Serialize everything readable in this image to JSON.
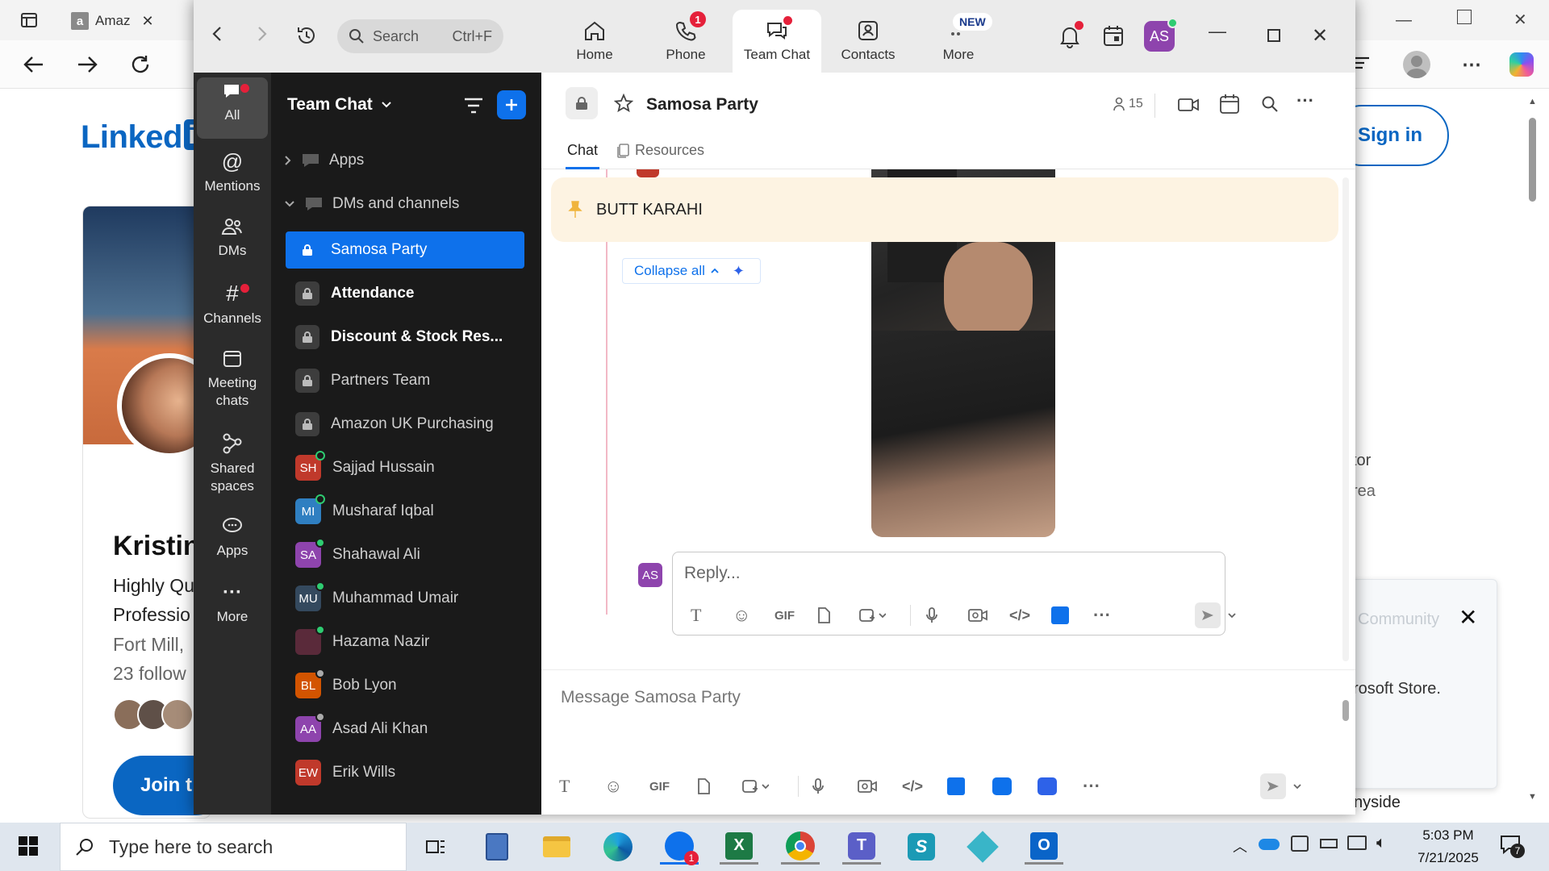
{
  "browser": {
    "tab_title": "Amaz",
    "page": {
      "logo": "Linked",
      "signin": "Sign in",
      "name": "Kristin",
      "headline1": "Highly Qu",
      "headline2": "Professio",
      "location": "Fort Mill,",
      "followers": "23 follow",
      "join": "Join t",
      "right1": "tor",
      "right2": "rea",
      "right3": "rosoft Store.",
      "right4": "nyside",
      "popup_text": "Community"
    }
  },
  "zoom": {
    "search_placeholder": "Search",
    "search_shortcut": "Ctrl+F",
    "nav": [
      {
        "label": "Home",
        "icon": "home-icon"
      },
      {
        "label": "Phone",
        "icon": "phone-icon",
        "badge": "1"
      },
      {
        "label": "Team Chat",
        "icon": "team-chat-icon"
      },
      {
        "label": "Contacts",
        "icon": "contacts-icon"
      },
      {
        "label": "More",
        "icon": "more-icon",
        "badge": "NEW"
      }
    ],
    "avatar_initials": "AS",
    "rail": [
      {
        "label": "All"
      },
      {
        "label": "Mentions"
      },
      {
        "label": "DMs"
      },
      {
        "label": "Channels"
      },
      {
        "label": "Meeting chats"
      },
      {
        "label": "Shared spaces"
      },
      {
        "label": "Apps"
      },
      {
        "label": "More"
      }
    ],
    "list": {
      "title": "Team Chat",
      "sections": [
        "Apps",
        "DMs and channels"
      ],
      "channels": [
        "Samosa Party",
        "Attendance",
        "Discount & Stock Res...",
        "Partners Team",
        "Amazon UK Purchasing"
      ],
      "dms": [
        {
          "initials": "SH",
          "name": "Sajjad Hussain",
          "color": "#c0392b"
        },
        {
          "initials": "MI",
          "name": "Musharaf Iqbal",
          "color": "#2f7fc1"
        },
        {
          "initials": "SA",
          "name": "Shahawal Ali",
          "color": "#8e44ad"
        },
        {
          "initials": "MU",
          "name": "Muhammad Umair",
          "color": "#34495e"
        },
        {
          "initials": "",
          "name": "Hazama Nazir",
          "color": "#5a2a3a"
        },
        {
          "initials": "BL",
          "name": "Bob Lyon",
          "color": "#d35400"
        },
        {
          "initials": "AA",
          "name": "Asad Ali Khan",
          "color": "#8e44ad"
        },
        {
          "initials": "EW",
          "name": "Erik Wills",
          "color": "#c0392b"
        }
      ]
    },
    "chat": {
      "title": "Samosa Party",
      "members": "15",
      "tabs": [
        "Chat",
        "Resources"
      ],
      "pinned": "BUTT KARAHI",
      "collapse": "Collapse all",
      "reply_placeholder": "Reply...",
      "reply_avatar": "AS",
      "message_placeholder": "Message Samosa Party",
      "gif": "GIF"
    }
  },
  "taskbar": {
    "search_placeholder": "Type here to search",
    "time": "5:03 PM",
    "date": "7/21/2025",
    "notif_count": "7",
    "zoom_badge": "1"
  }
}
